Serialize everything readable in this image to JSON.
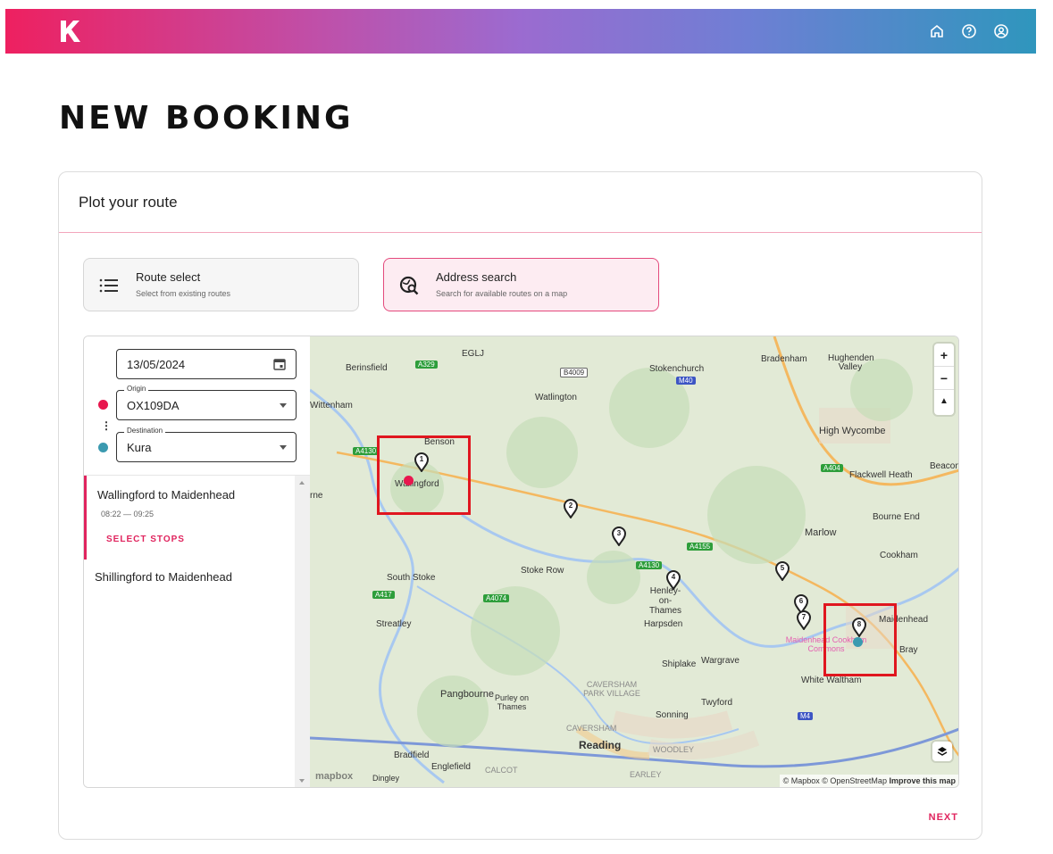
{
  "app": {
    "logo_icon": "k-logo-icon",
    "nav_icons": [
      "home-icon",
      "help-icon",
      "account-icon"
    ]
  },
  "page": {
    "title": "NEW BOOKING"
  },
  "card": {
    "header": "Plot your route",
    "next_label": "NEXT"
  },
  "modes": {
    "route_select": {
      "title": "Route select",
      "subtitle": "Select from existing routes",
      "icon": "list-icon"
    },
    "address_search": {
      "title": "Address search",
      "subtitle": "Search for available routes on a map",
      "icon": "map-search-icon",
      "selected": true
    }
  },
  "form": {
    "date": "13/05/2024",
    "origin": {
      "label": "Origin",
      "value": "OX109DA",
      "color": "#e8174e"
    },
    "destination": {
      "label": "Destination",
      "value": "Kura",
      "color": "#3b9ab0"
    }
  },
  "results": [
    {
      "title": "Wallingford to Maidenhead",
      "time": "08:22 — 09:25",
      "action": "SELECT STOPS"
    },
    {
      "title": "Shillingford to Maidenhead"
    }
  ],
  "map": {
    "places": [
      "Berinsfield",
      "EGLJ",
      "Stokenchurch",
      "Bradenham",
      "Hughenden Valley",
      "Watlington",
      "Wittenham",
      "Benson",
      "Wallingford",
      "High Wycombe",
      "Beacon",
      "Flackwell Heath",
      "Bourne End",
      "Marlow",
      "Cookham",
      "South Stoke",
      "Stoke Row",
      "Henley-on-Thames",
      "Streatley",
      "Harpsden",
      "Maidenhead",
      "Maidenhead Cookham Commons",
      "Bray",
      "Shiplake",
      "Wargrave",
      "White Waltham",
      "Pangbourne",
      "Purley on Thames",
      "CAVERSHAM PARK VILLAGE",
      "Sonning",
      "Twyford",
      "CAVERSHAM",
      "Reading",
      "WOODLEY",
      "Bradfield",
      "Englefield",
      "CALCOT",
      "EARLEY",
      "Dingley",
      "rne"
    ],
    "road_labels": [
      "A329",
      "B4009",
      "M40",
      "A4130",
      "A404",
      "A4155",
      "A417",
      "A4074",
      "A4130",
      "M4"
    ],
    "stops": [
      "1",
      "2",
      "3",
      "4",
      "5",
      "6",
      "7",
      "8"
    ],
    "attribution": "© Mapbox © OpenStreetMap",
    "improve": "Improve this map",
    "mapbox": "mapbox"
  }
}
